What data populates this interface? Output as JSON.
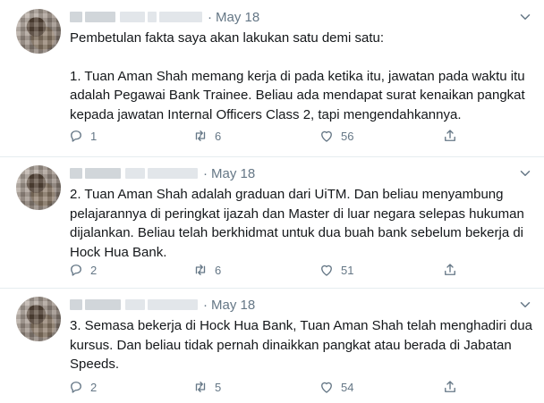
{
  "tweets": [
    {
      "date": "May 18",
      "paragraphs": [
        "Pembetulan fakta saya akan lakukan satu demi satu:",
        "",
        "1. Tuan Aman Shah memang kerja di pada ketika itu, jawatan pada waktu itu adalah Pegawai Bank Trainee. Beliau ada mendapat surat kenaikan pangkat kepada jawatan Internal Officers Class 2, tapi mengendahkannya."
      ],
      "replies": "1",
      "retweets": "6",
      "likes": "56"
    },
    {
      "date": "May 18",
      "paragraphs": [
        "2. Tuan Aman Shah adalah graduan dari UiTM. Dan beliau menyambung pelajarannya di peringkat ijazah dan Master di luar negara selepas hukuman dijalankan. Beliau telah berkhidmat untuk dua buah bank sebelum bekerja di Hock Hua Bank."
      ],
      "replies": "2",
      "retweets": "6",
      "likes": "51"
    },
    {
      "date": "May 18",
      "paragraphs": [
        "3. Semasa bekerja di Hock Hua Bank, Tuan Aman Shah telah menghadiri dua kursus. Dan beliau tidak pernah dinaikkan pangkat atau berada di Jabatan Speeds."
      ],
      "replies": "2",
      "retweets": "5",
      "likes": "54"
    }
  ],
  "separator": "·",
  "icons": {
    "reply": "reply-icon",
    "retweet": "retweet-icon",
    "like": "heart-icon",
    "share": "share-icon",
    "more": "chevron-down-icon"
  },
  "colors": {
    "text": "#14171a",
    "muted": "#657786",
    "divider": "#e6ecf0"
  }
}
